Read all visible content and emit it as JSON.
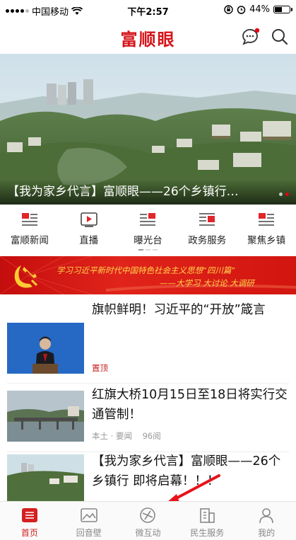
{
  "status_bar": {
    "carrier": "中国移动",
    "time": "下午2:57",
    "battery": "44%",
    "battery_level": 0.44
  },
  "header": {
    "app_title": "富顺眼",
    "message_icon": "chat-bubble-icon",
    "search_icon": "search-icon"
  },
  "banner": {
    "caption": "【我为家乡代言】富顺眼——26个乡镇行…",
    "slide_count": 2,
    "active_slide": 2
  },
  "categories": [
    {
      "label": "富顺新闻",
      "icon": "news-icon"
    },
    {
      "label": "直播",
      "icon": "video-play-icon"
    },
    {
      "label": "曝光台",
      "icon": "exposure-icon"
    },
    {
      "label": "政务服务",
      "icon": "government-icon"
    },
    {
      "label": "聚焦乡镇",
      "icon": "town-focus-icon"
    }
  ],
  "promo": {
    "line1": "学习习近平新时代中国特色社会主义思想“四川篇”",
    "line2": "——大学习  大讨论  大调研"
  },
  "news": [
    {
      "title": "旗帜鲜明！习近平的“开放”箴言",
      "tag": "置顶",
      "source": "",
      "views": ""
    },
    {
      "title": "红旗大桥10月15日至18日将实行交通管制！",
      "tag": "",
      "source": "本土 · 要闻",
      "views": "96阅"
    },
    {
      "title": "【我为家乡代言】富顺眼——26个乡镇行 即将启幕！！！",
      "tag": "",
      "source": "",
      "views": ""
    }
  ],
  "tabbar": [
    {
      "label": "首页",
      "icon": "home-icon",
      "active": true
    },
    {
      "label": "回音壁",
      "icon": "image-wall-icon",
      "active": false
    },
    {
      "label": "微互动",
      "icon": "interaction-icon",
      "active": false
    },
    {
      "label": "民生服务",
      "icon": "building-icon",
      "active": false
    },
    {
      "label": "我的",
      "icon": "user-icon",
      "active": false
    }
  ],
  "colors": {
    "brand_red": "#d4141a",
    "promo_gold": "#ffd54a",
    "tab_active": "#d42020",
    "tab_inactive": "#888888"
  }
}
